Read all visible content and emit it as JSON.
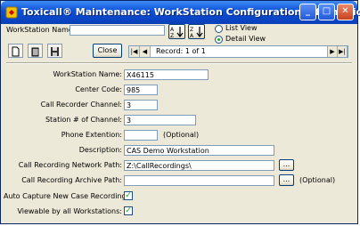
{
  "window": {
    "title": "Toxicall® Maintenance: WorkStation Configuration Information"
  },
  "toolbar": {
    "workstation_name_label": "WorkStation Name",
    "workstation_name_value": "",
    "close_label": "Close",
    "record_label": "Record: 1 of 1"
  },
  "view": {
    "list_view_label": "List View",
    "detail_view_label": "Detail View",
    "selected": "Detail View"
  },
  "form": {
    "workstation_name": {
      "label": "WorkStation Name:",
      "value": "X46115"
    },
    "center_code": {
      "label": "Center Code:",
      "value": "985"
    },
    "call_recorder_channel": {
      "label": "Call Recorder Channel:",
      "value": "3"
    },
    "station_of_channel": {
      "label": "Station # of Channel:",
      "value": "3"
    },
    "phone_extention": {
      "label": "Phone Extention:",
      "value": "",
      "note": "(Optional)"
    },
    "description": {
      "label": "Description:",
      "value": "CAS Demo Workstation"
    },
    "network_path": {
      "label": "Call Recording Network Path:",
      "value": "Z:\\CallRecordings\\",
      "browse": "..."
    },
    "archive_path": {
      "label": "Call Recording Archive Path:",
      "value": "",
      "browse": "...",
      "note": "(Optional)"
    },
    "auto_capture": {
      "label": "Auto Capture New Case Recordings:",
      "checked": true
    },
    "viewable": {
      "label": "Viewable by all Workstations:",
      "checked": true
    }
  }
}
